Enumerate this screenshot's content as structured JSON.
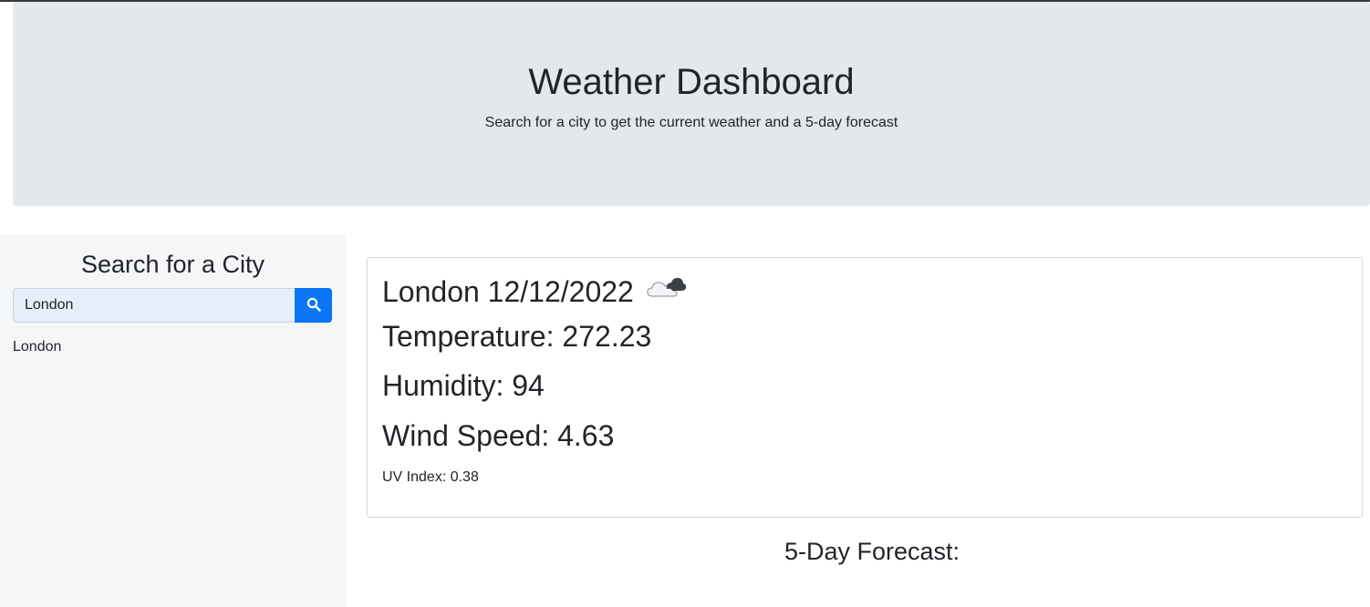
{
  "header": {
    "title": "Weather Dashboard",
    "subtitle": "Search for a city to get the current weather and a 5-day forecast"
  },
  "sidebar": {
    "heading": "Search for a City",
    "search": {
      "value": "London",
      "placeholder": "",
      "button_icon": "search-icon",
      "button_color": "#0b76f5"
    },
    "history": [
      "London"
    ]
  },
  "current": {
    "city_date": "London 12/12/2022",
    "icon": "cloudy-icon",
    "temperature": "Temperature: 272.23",
    "humidity": "Humidity: 94",
    "wind": "Wind Speed: 4.63",
    "uv": "UV Index: 0.38"
  },
  "forecast": {
    "heading": "5-Day Forecast:"
  }
}
